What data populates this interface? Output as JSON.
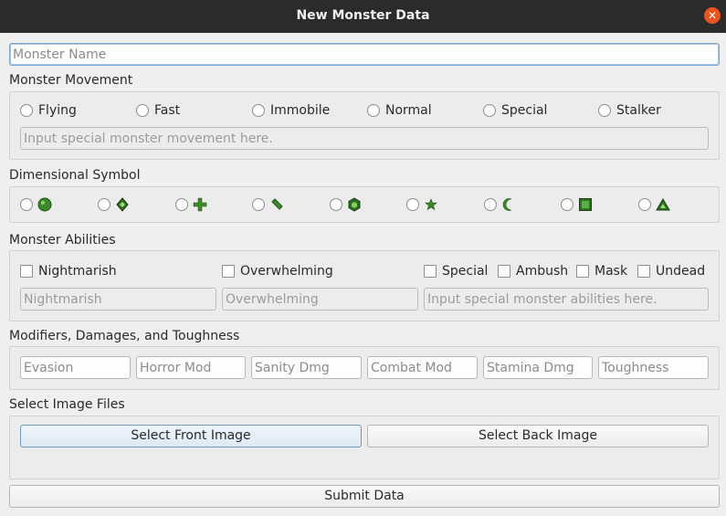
{
  "window": {
    "title": "New Monster Data",
    "close_icon": "close-icon"
  },
  "name_field": {
    "placeholder": "Monster Name",
    "value": ""
  },
  "movement": {
    "label": "Monster Movement",
    "options": [
      "Flying",
      "Fast",
      "Immobile",
      "Normal",
      "Special",
      "Stalker"
    ],
    "special_placeholder": "Input special monster movement here."
  },
  "dimensional": {
    "label": "Dimensional Symbol",
    "symbols": [
      "circle-symbol-icon",
      "diamond-symbol-icon",
      "cross-symbol-icon",
      "slash-symbol-icon",
      "hexagon-symbol-icon",
      "star-symbol-icon",
      "crescent-symbol-icon",
      "square-symbol-icon",
      "triangle-symbol-icon"
    ],
    "symbol_color": "#3d8a2c"
  },
  "abilities": {
    "label": "Monster Abilities",
    "checks": [
      "Nightmarish",
      "Overwhelming",
      "Special",
      "Ambush",
      "Mask",
      "Undead"
    ],
    "nightmarish_placeholder": "Nightmarish",
    "overwhelming_placeholder": "Overwhelming",
    "special_placeholder": "Input special monster abilities here."
  },
  "modifiers": {
    "label": "Modifiers, Damages, and Toughness",
    "fields": [
      "Evasion",
      "Horror Mod",
      "Sanity Dmg",
      "Combat Mod",
      "Stamina Dmg",
      "Toughness"
    ]
  },
  "images": {
    "label": "Select Image Files",
    "front_button": "Select Front Image",
    "back_button": "Select Back Image"
  },
  "submit": {
    "label": "Submit Data"
  },
  "colors": {
    "titlebar": "#2b2b2b",
    "close": "#e95420",
    "focus": "#7aa6cf"
  }
}
